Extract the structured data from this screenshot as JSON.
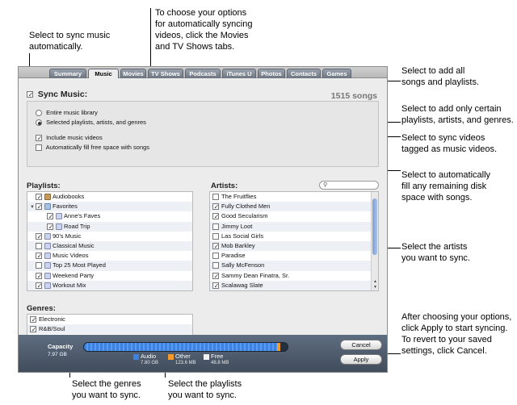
{
  "callouts": {
    "sync_music": [
      "Select to sync music",
      "automatically."
    ],
    "tabs_info": [
      "To choose your options",
      "for automatically syncing",
      "videos, click the Movies",
      "and TV Shows tabs."
    ],
    "add_all": [
      "Select to add all",
      "songs and playlists."
    ],
    "add_certain": [
      "Select to add only certain",
      "playlists, artists, and genres."
    ],
    "sync_videos": [
      "Select to sync videos",
      "tagged as music videos."
    ],
    "autofill": [
      "Select to automatically",
      "fill any remaining disk",
      "space with songs."
    ],
    "artists": [
      "Select the artists",
      "you want to sync."
    ],
    "apply": [
      "After choosing your options,",
      "click Apply to start syncing.",
      "To revert to your saved",
      "settings, click Cancel."
    ],
    "genres": [
      "Select the genres",
      "you want to sync."
    ],
    "playlists": [
      "Select the playlists",
      "you want to sync."
    ]
  },
  "tabs": [
    "Summary",
    "Music",
    "Movies",
    "TV Shows",
    "Podcasts",
    "iTunes U",
    "Photos",
    "Contacts",
    "Games"
  ],
  "sync": {
    "label": "Sync Music:",
    "song_count": "1515 songs"
  },
  "options": {
    "entire_library": "Entire music library",
    "selected": "Selected playlists, artists, and genres",
    "include_videos": "Include music videos",
    "autofill": "Automatically fill free space with songs"
  },
  "playlists": {
    "title": "Playlists:",
    "items": [
      {
        "label": "Audiobooks",
        "checked": true,
        "icon": "book",
        "indent": 0
      },
      {
        "label": "Favorites",
        "checked": true,
        "icon": "folder",
        "indent": 0,
        "expanded": true
      },
      {
        "label": "Anne's Faves",
        "checked": true,
        "icon": "playlist",
        "indent": 1
      },
      {
        "label": "Road Trip",
        "checked": true,
        "icon": "playlist",
        "indent": 1
      },
      {
        "label": "90's Music",
        "checked": true,
        "icon": "playlist",
        "indent": 0
      },
      {
        "label": "Classical Music",
        "checked": false,
        "icon": "playlist",
        "indent": 0
      },
      {
        "label": "Music Videos",
        "checked": true,
        "icon": "playlist",
        "indent": 0
      },
      {
        "label": "Top 25 Most Played",
        "checked": false,
        "icon": "playlist",
        "indent": 0
      },
      {
        "label": "Weekend Party",
        "checked": true,
        "icon": "playlist",
        "indent": 0
      },
      {
        "label": "Workout Mix",
        "checked": true,
        "icon": "playlist",
        "indent": 0
      }
    ]
  },
  "artists": {
    "title": "Artists:",
    "search_placeholder": "",
    "items": [
      {
        "label": "The Fruitflies",
        "checked": false
      },
      {
        "label": "Fully Clothed Men",
        "checked": true
      },
      {
        "label": "Good Secularism",
        "checked": true
      },
      {
        "label": "Jimmy Loot",
        "checked": false
      },
      {
        "label": "Las Social Girls",
        "checked": false
      },
      {
        "label": "Mob Barkley",
        "checked": true
      },
      {
        "label": "Paradise",
        "checked": false
      },
      {
        "label": "Sally McFenson",
        "checked": false
      },
      {
        "label": "Sammy Dean Finatra, Sr.",
        "checked": true
      },
      {
        "label": "Scalawag Slate",
        "checked": true
      }
    ]
  },
  "genres": {
    "title": "Genres:",
    "items": [
      {
        "label": "Electronic",
        "checked": true
      },
      {
        "label": "R&B/Soul",
        "checked": true
      }
    ]
  },
  "capacity": {
    "label": "Capacity",
    "total": "7.97 GB",
    "audio_fraction": 0.95,
    "other_fraction": 0.015,
    "legend": [
      {
        "name": "Audio",
        "size": "7.80 GB",
        "color": "#3c82e0"
      },
      {
        "name": "Other",
        "size": "123.6 MB",
        "color": "#f39a2d"
      },
      {
        "name": "Free",
        "size": "48.8 MB",
        "color": "#f2f2f2"
      }
    ]
  },
  "buttons": {
    "cancel": "Cancel",
    "apply": "Apply"
  }
}
